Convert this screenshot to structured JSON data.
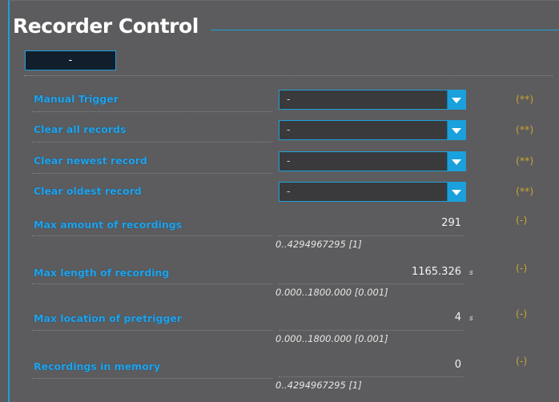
{
  "panel": {
    "title": "Recorder Control",
    "collapse_label": "-"
  },
  "triggers": [
    {
      "label": "Manual Trigger",
      "value": "-",
      "status": "(**)"
    },
    {
      "label": "Clear all records",
      "value": "-",
      "status": "(**)"
    },
    {
      "label": "Clear newest record",
      "value": "-",
      "status": "(**)"
    },
    {
      "label": "Clear oldest record",
      "value": "-",
      "status": "(**)"
    }
  ],
  "params": [
    {
      "label": "Max amount of recordings",
      "value": "291",
      "unit": "",
      "range": "0..4294967295 [1]",
      "status": "(-)"
    },
    {
      "label": "Max length of recording",
      "value": "1165.326",
      "unit": "s",
      "range": "0.000..1800.000 [0.001]",
      "status": "(-)"
    },
    {
      "label": "Max location of pretrigger",
      "value": "4",
      "unit": "s",
      "range": "0.000..1800.000 [0.001]",
      "status": "(-)"
    },
    {
      "label": "Recordings in memory",
      "value": "0",
      "unit": "",
      "range": "0..4294967295 [1]",
      "status": "(-)"
    }
  ],
  "colors": {
    "accent": "#1f9fd6",
    "label": "#22a2ea",
    "status": "#c9a233",
    "background": "#5c5c5e"
  },
  "icons": {
    "dropdown_arrow": "chevron-down-icon"
  }
}
